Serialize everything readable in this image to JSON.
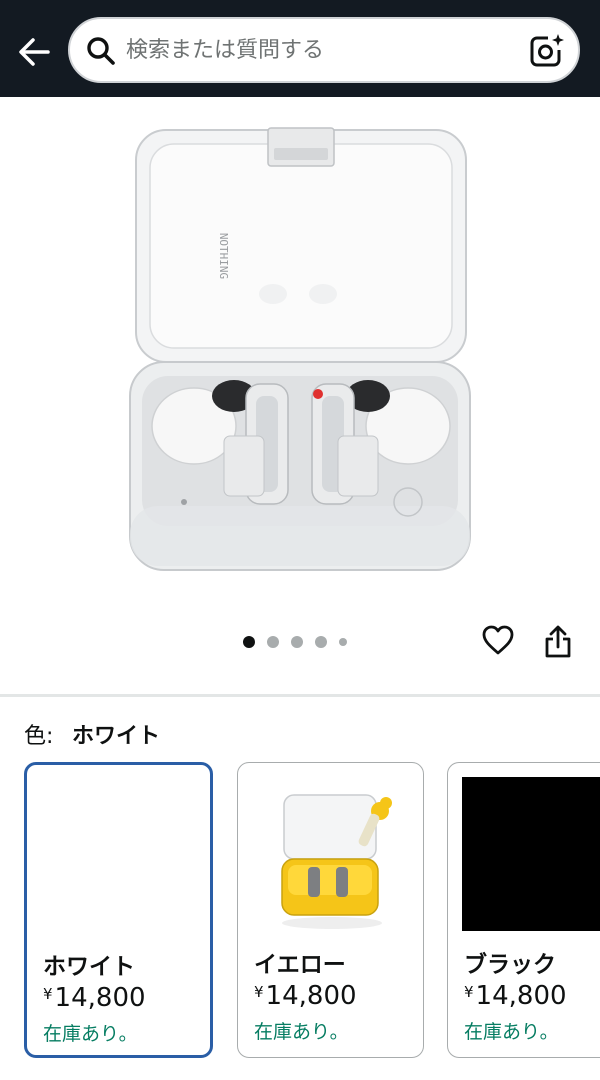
{
  "header": {
    "search_placeholder": "検索または質問する",
    "icons": {
      "back": "arrow-left-icon",
      "search": "search-icon",
      "camera": "camera-lens-icon"
    }
  },
  "gallery": {
    "dot_count": 5,
    "active_dot": 1,
    "icons": {
      "favorite": "heart-icon",
      "share": "share-icon"
    }
  },
  "color": {
    "label": "色:",
    "selected": "ホワイト"
  },
  "swatches": [
    {
      "name": "ホワイト",
      "currency": "¥",
      "price": "14,800",
      "stock": "在庫あり。",
      "selected": true
    },
    {
      "name": "イエロー",
      "currency": "¥",
      "price": "14,800",
      "stock": "在庫あり。",
      "selected": false
    },
    {
      "name": "ブラック",
      "currency": "¥",
      "price": "14,800",
      "stock": "在庫あり。",
      "selected": false
    }
  ],
  "colors": {
    "header_bg": "#131a22",
    "selected_border": "#2a5ea6",
    "stock_green": "#067d62",
    "yellow": "#f5c518"
  }
}
